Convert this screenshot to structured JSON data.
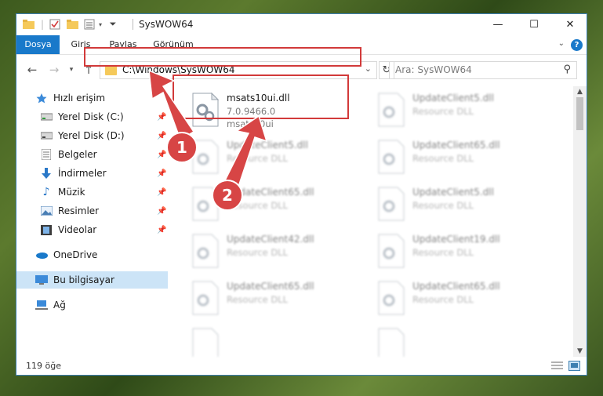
{
  "window": {
    "title": "SysWOW64",
    "controls": {
      "minimize": "—",
      "maximize": "☐",
      "close": "✕"
    }
  },
  "ribbon": {
    "tabs": [
      "Dosya",
      "Giriş",
      "Paylaş",
      "Görünüm"
    ],
    "help": "?"
  },
  "nav": {
    "address": "C:\\Windows\\SysWOW64",
    "search_placeholder": "Ara: SysWOW64"
  },
  "sidebar": {
    "items": [
      {
        "label": "Hızlı erişim",
        "icon": "star-icon",
        "pinned": false
      },
      {
        "label": "Yerel Disk (C:)",
        "icon": "drive-icon",
        "pinned": true
      },
      {
        "label": "Yerel Disk (D:)",
        "icon": "drive-icon",
        "pinned": true
      },
      {
        "label": "Belgeler",
        "icon": "documents-icon",
        "pinned": true
      },
      {
        "label": "İndirmeler",
        "icon": "download-icon",
        "pinned": true
      },
      {
        "label": "Müzik",
        "icon": "music-icon",
        "pinned": true
      },
      {
        "label": "Resimler",
        "icon": "pictures-icon",
        "pinned": true
      },
      {
        "label": "Videolar",
        "icon": "videos-icon",
        "pinned": true
      },
      {
        "label": "OneDrive",
        "icon": "cloud-icon",
        "pinned": false
      },
      {
        "label": "Bu bilgisayar",
        "icon": "computer-icon",
        "pinned": false
      },
      {
        "label": "Ağ",
        "icon": "network-icon",
        "pinned": false
      }
    ]
  },
  "files": {
    "highlighted": {
      "name": "msats10ui.dll",
      "version": "7.0.9466.0",
      "description": "msats10ui"
    },
    "blurred": [
      {
        "name": "UpdateClient5.dll",
        "sub": "Resource DLL"
      },
      {
        "name": "UpdateClient5.dll",
        "sub": "Resource DLL"
      },
      {
        "name": "UpdateClient65.dll",
        "sub": "Resource DLL"
      },
      {
        "name": "UpdateClient65.dll",
        "sub": "Resource DLL"
      },
      {
        "name": "UpdateClient5.dll",
        "sub": "Resource DLL"
      },
      {
        "name": "UpdateClient42.dll",
        "sub": "Resource DLL"
      },
      {
        "name": "UpdateClient19.dll",
        "sub": "Resource DLL"
      },
      {
        "name": "UpdateClient65.dll",
        "sub": "Resource DLL"
      },
      {
        "name": "UpdateClient65.dll",
        "sub": "Resource DLL"
      }
    ]
  },
  "status": {
    "item_count": "119 öğe"
  },
  "annotations": {
    "step1": "1",
    "step2": "2"
  },
  "colors": {
    "accent": "#1979ca",
    "highlight": "#d23a3a",
    "selected": "#cce4f7"
  }
}
